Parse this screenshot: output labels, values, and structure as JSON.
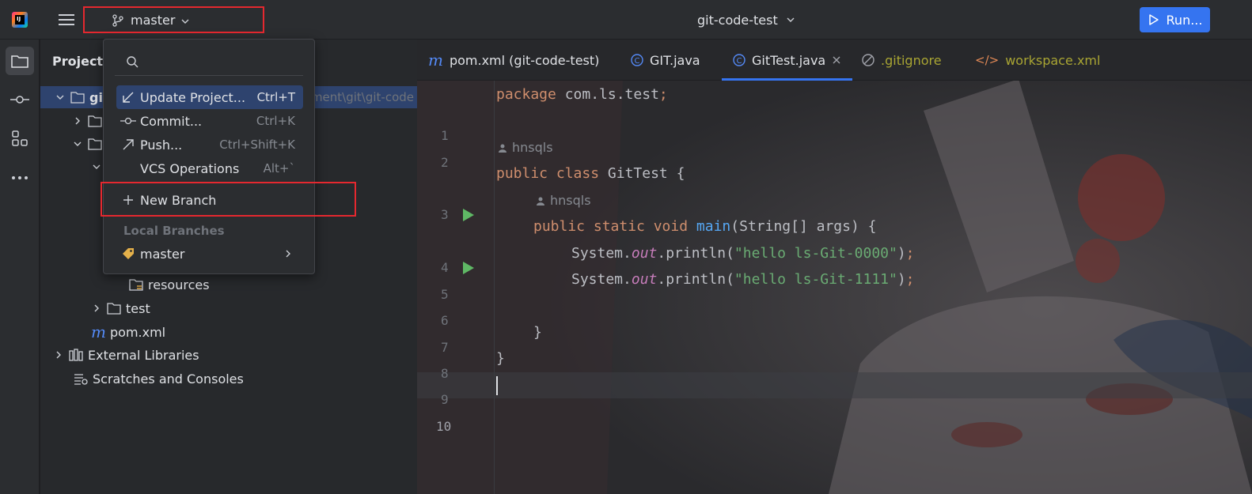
{
  "topbar": {
    "branch": "master",
    "project": "git-code-test",
    "run_label": "Run..."
  },
  "project_panel": {
    "title": "Project",
    "root_label_partial": "gi",
    "root_path_partial": "ment\\git\\git-code",
    "tree": [
      {
        "label": "resources"
      },
      {
        "label": "test"
      },
      {
        "label": "pom.xml"
      },
      {
        "label": "External Libraries"
      },
      {
        "label": "Scratches and Consoles"
      }
    ]
  },
  "tabs": [
    {
      "label": "pom.xml (git-code-test)",
      "color": "#dfe1e5"
    },
    {
      "label": "GIT.java",
      "color": "#dfe1e5"
    },
    {
      "label": "GitTest.java",
      "color": "#dfe1e5",
      "active": true
    },
    {
      "label": ".gitignore",
      "color": "#a9a533"
    },
    {
      "label": "workspace.xml",
      "color": "#a9a533"
    }
  ],
  "editor": {
    "line_numbers": [
      "1",
      "2",
      "3",
      "4",
      "5",
      "6",
      "7",
      "8",
      "9",
      "10"
    ],
    "author_hint_1": "hnsqls",
    "author_hint_2": "hnsqls",
    "code": {
      "l1_kw": "package",
      "l1_rest": " com.ls.test",
      "l1_semi": ";",
      "l3_kw1": "public",
      "l3_kw2": "class",
      "l3_rest": " GitTest {",
      "l4_kw": "public static void ",
      "l4_fn": "main",
      "l4_rest": "(String[] args) {",
      "l5_a": "System.",
      "l5_out": "out",
      "l5_b": ".println(",
      "l5_str": "\"hello ls-Git-0000\"",
      "l5_c": ")",
      "l5_semi": ";",
      "l6_a": "System.",
      "l6_out": "out",
      "l6_b": ".println(",
      "l6_str": "\"hello ls-Git-1111\"",
      "l6_c": ")",
      "l6_semi": ";",
      "l8": "}",
      "l9": "}"
    }
  },
  "popup": {
    "search_placeholder": "",
    "items": [
      {
        "label": "Update Project...",
        "shortcut": "Ctrl+T"
      },
      {
        "label": "Commit...",
        "shortcut": "Ctrl+K"
      },
      {
        "label": "Push...",
        "shortcut": "Ctrl+Shift+K"
      },
      {
        "label": "VCS Operations",
        "shortcut": "Alt+`"
      },
      {
        "label": "New Branch",
        "shortcut": ""
      }
    ],
    "section_local": "Local Branches",
    "local_branch": "master"
  },
  "colors": {
    "accent": "#3574f0",
    "highlight_box": "#e5282f",
    "run_gutter": "#5fb865"
  }
}
